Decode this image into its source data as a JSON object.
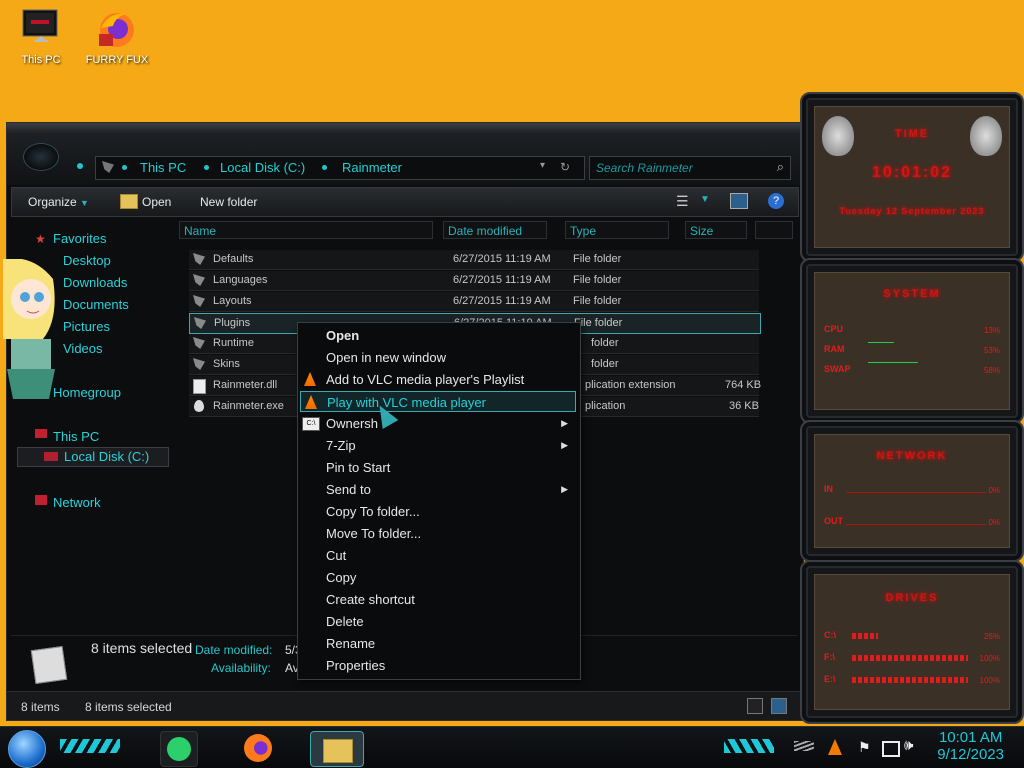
{
  "desktop": {
    "icons": [
      {
        "label": "This PC"
      },
      {
        "label": "FURRY FUX"
      }
    ]
  },
  "explorer": {
    "breadcrumb": [
      "This PC",
      "Local Disk (C:)",
      "Rainmeter"
    ],
    "search_placeholder": "Search Rainmeter",
    "toolbar": {
      "organize": "Organize",
      "open": "Open",
      "new_folder": "New folder"
    },
    "nav": {
      "favorites": "Favorites",
      "desktop": "Desktop",
      "downloads": "Downloads",
      "documents": "Documents",
      "pictures": "Pictures",
      "videos": "Videos",
      "homegroup": "Homegroup",
      "this_pc": "This PC",
      "local_disk": "Local Disk (C:)",
      "network": "Network"
    },
    "columns": {
      "name": "Name",
      "date": "Date modified",
      "type": "Type",
      "size": "Size"
    },
    "files": [
      {
        "name": "Defaults",
        "date": "6/27/2015 11:19 AM",
        "type": "File folder",
        "size": ""
      },
      {
        "name": "Languages",
        "date": "6/27/2015 11:19 AM",
        "type": "File folder",
        "size": ""
      },
      {
        "name": "Layouts",
        "date": "6/27/2015 11:19 AM",
        "type": "File folder",
        "size": ""
      },
      {
        "name": "Plugins",
        "date": "6/27/2015 11:19 AM",
        "type": "File folder",
        "size": ""
      },
      {
        "name": "Runtime",
        "date": "",
        "type": "folder",
        "size": ""
      },
      {
        "name": "Skins",
        "date": "",
        "type": "folder",
        "size": ""
      },
      {
        "name": "Rainmeter.dll",
        "date": "",
        "type": "plication extension",
        "size": "764 KB"
      },
      {
        "name": "Rainmeter.exe",
        "date": "",
        "type": "plication",
        "size": "36 KB"
      }
    ],
    "details": {
      "selected": "8 items selected",
      "date_label": "Date modified:",
      "date_value": "5/3",
      "avail_label": "Availability:",
      "avail_value": "Ava"
    },
    "status": {
      "count": "8 items",
      "selected": "8 items selected"
    }
  },
  "context_menu": {
    "items": [
      {
        "label": "Open",
        "bold": true
      },
      {
        "label": "Open in new window"
      },
      {
        "label": "Add to VLC media player's Playlist",
        "icon": "vlc-icon"
      },
      {
        "label": "Play with VLC media player",
        "icon": "vlc-icon",
        "highlighted": true
      },
      {
        "label": "Ownersh",
        "icon": "cmd-icon",
        "submenu": true
      },
      {
        "label": "7-Zip",
        "submenu": true
      },
      {
        "label": "Pin to Start"
      },
      {
        "label": "Send to",
        "submenu": true
      },
      {
        "label": "Copy To folder..."
      },
      {
        "label": "Move To folder..."
      },
      {
        "label": "Cut"
      },
      {
        "label": "Copy"
      },
      {
        "label": "Create shortcut"
      },
      {
        "label": "Delete"
      },
      {
        "label": "Rename"
      },
      {
        "label": "Properties"
      }
    ]
  },
  "widgets": {
    "time": {
      "title": "TIME",
      "clock": "10:01:02",
      "date": "Tuesday 12 September 2023"
    },
    "system": {
      "title": "SYSTEM",
      "cpu": "CPU",
      "ram": "RAM",
      "swap": "SWAP",
      "cpu_val": "13%",
      "ram_val": "53%",
      "swap_val": "58%"
    },
    "network": {
      "title": "NETWORK",
      "in": "IN",
      "out": "OUT",
      "in_val": "0%",
      "out_val": "0%"
    },
    "drives": {
      "title": "DRIVES",
      "c": "C:\\",
      "f": "F:\\",
      "e": "E:\\",
      "c_val": "26%",
      "f_val": "100%",
      "e_val": "100%"
    }
  },
  "taskbar": {
    "time": "10:01 AM",
    "date": "9/12/2023"
  },
  "colors": {
    "accent": "#22d2d8",
    "desktop": "#f5a916",
    "widget_red": "#e21c1c"
  }
}
